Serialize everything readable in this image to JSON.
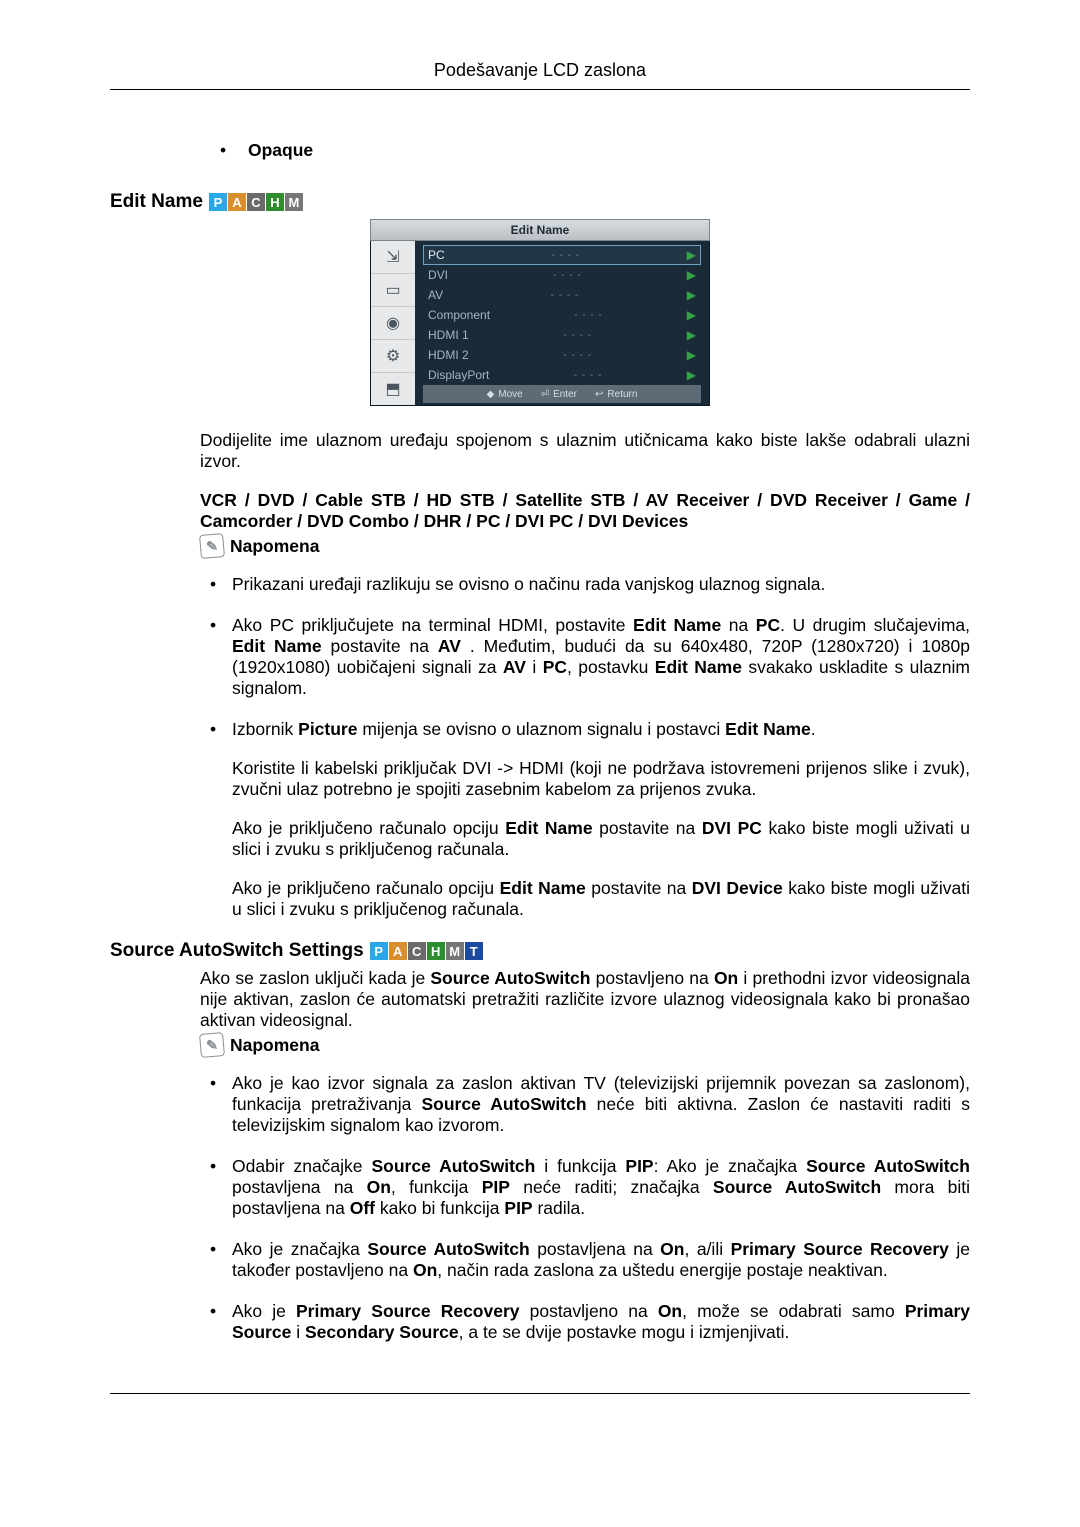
{
  "header": {
    "title": "Podešavanje LCD zaslona"
  },
  "opaque_bullet": "Opaque",
  "sections": {
    "edit_name": {
      "heading": "Edit Name",
      "modes": [
        "P",
        "A",
        "C",
        "H",
        "M"
      ],
      "osd": {
        "title": "Edit Name",
        "items": [
          {
            "name": "PC",
            "value": "- - - -",
            "selected": true
          },
          {
            "name": "DVI",
            "value": "- - - -",
            "selected": false
          },
          {
            "name": "AV",
            "value": "- - - -",
            "selected": false
          },
          {
            "name": "Component",
            "value": "- - - -",
            "selected": false
          },
          {
            "name": "HDMI 1",
            "value": "- - - -",
            "selected": false
          },
          {
            "name": "HDMI 2",
            "value": "- - - -",
            "selected": false
          },
          {
            "name": "DisplayPort",
            "value": "- - - -",
            "selected": false
          }
        ],
        "footer": {
          "move": "Move",
          "enter": "Enter",
          "return": "Return"
        }
      },
      "intro": "Dodijelite ime ulaznom uređaju spojenom s ulaznim utičnicama kako biste lakše odabrali ulazni izvor.",
      "device_list": "VCR / DVD / Cable STB / HD STB / Satellite STB / AV Receiver / DVD Receiver / Game / Camcorder / DVD Combo / DHR / PC / DVI PC / DVI Devices",
      "note_label": "Napomena",
      "bullets": {
        "b1": "Prikazani uređaji razlikuju se ovisno o načinu rada vanjskog ulaznog signala.",
        "b2_pre": "Ako PC priključujete na terminal HDMI, postavite ",
        "b2_bold1": "Edit Name",
        "b2_mid1": " na ",
        "b2_bold2": "PC",
        "b2_mid2": ". U drugim slučajevima, ",
        "b2_bold3": "Edit Name",
        "b2_mid3": " postavite na ",
        "b2_bold4": "AV",
        "b2_mid4": " . Međutim, budući da su 640x480, 720P (1280x720) i 1080p (1920x1080) uobičajeni signali za ",
        "b2_bold5": "AV",
        "b2_mid5": " i ",
        "b2_bold6": "PC",
        "b2_mid6": ", postavku ",
        "b2_bold7": "Edit Name",
        "b2_post": " svakako uskladite s ulaznim signalom.",
        "b3_pre": "Izbornik ",
        "b3_bold1": "Picture",
        "b3_mid": " mijenja se ovisno o ulaznom signalu i postavci ",
        "b3_bold2": "Edit Name",
        "b3_post": ".",
        "b3_p1": "Koristite li kabelski priključak DVI -> HDMI (koji ne podržava istovremeni prijenos slike i zvuk), zvučni ulaz potrebno je spojiti zasebnim kabelom za prijenos zvuka.",
        "b3_p2_pre": "Ako je priključeno računalo opciju ",
        "b3_p2_b1": "Edit Name",
        "b3_p2_mid": " postavite na ",
        "b3_p2_b2": "DVI PC",
        "b3_p2_post": " kako biste mogli uživati u slici i zvuku s priključenog računala.",
        "b3_p3_pre": "Ako je priključeno računalo opciju ",
        "b3_p3_b1": "Edit Name",
        "b3_p3_mid": " postavite na ",
        "b3_p3_b2": "DVI Device",
        "b3_p3_post": " kako biste mogli uživati u slici i zvuku s priključenog računala."
      }
    },
    "autoswitch": {
      "heading": "Source AutoSwitch Settings",
      "modes": [
        "P",
        "A",
        "C",
        "H",
        "M",
        "T"
      ],
      "intro_pre": "Ako se zaslon uključi kada je ",
      "intro_b1": "Source AutoSwitch",
      "intro_mid1": " postavljeno na ",
      "intro_b2": "On",
      "intro_post": " i prethodni izvor videosignala nije aktivan, zaslon će automatski pretražiti različite izvore ulaznog videosignala kako bi pronašao aktivan videosignal.",
      "note_label": "Napomena",
      "bullets": {
        "c1_pre": "Ako je kao izvor signala za zaslon aktivan TV (televizijski prijemnik povezan sa zaslonom), funkacija pretraživanja ",
        "c1_b1": "Source AutoSwitch",
        "c1_post": " neće biti aktivna. Zaslon će nastaviti raditi s televizijskim signalom kao izvorom.",
        "c2_pre": "Odabir značajke ",
        "c2_b1": "Source AutoSwitch",
        "c2_mid1": " i funkcija ",
        "c2_b2": "PIP",
        "c2_mid2": ": Ako je značajka ",
        "c2_b3": "Source AutoSwitch",
        "c2_mid3": " postavljena na ",
        "c2_b4": "On",
        "c2_mid4": ", funkcija ",
        "c2_b5": "PIP",
        "c2_mid5": " neće raditi; značajka ",
        "c2_b6": "Source AutoSwitch",
        "c2_mid6": " mora biti postavljena na ",
        "c2_b7": "Off",
        "c2_mid7": " kako bi funkcija ",
        "c2_b8": "PIP",
        "c2_post": " radila.",
        "c3_pre": "Ako je značajka ",
        "c3_b1": "Source AutoSwitch",
        "c3_mid1": " postavljena na ",
        "c3_b2": "On",
        "c3_mid2": ", a/ili ",
        "c3_b3": "Primary Source Recovery",
        "c3_mid3": " je također postavljeno na ",
        "c3_b4": "On",
        "c3_post": ", način rada zaslona za uštedu energije postaje neaktivan.",
        "c4_pre": "Ako je ",
        "c4_b1": "Primary Source Recovery",
        "c4_mid1": " postavljeno na ",
        "c4_b2": "On",
        "c4_mid2": ", može se odabrati samo ",
        "c4_b3": "Primary Source",
        "c4_mid3": " i ",
        "c4_b4": "Secondary Source",
        "c4_post": ", a te se dvije postavke mogu i izmjenjivati."
      }
    }
  }
}
